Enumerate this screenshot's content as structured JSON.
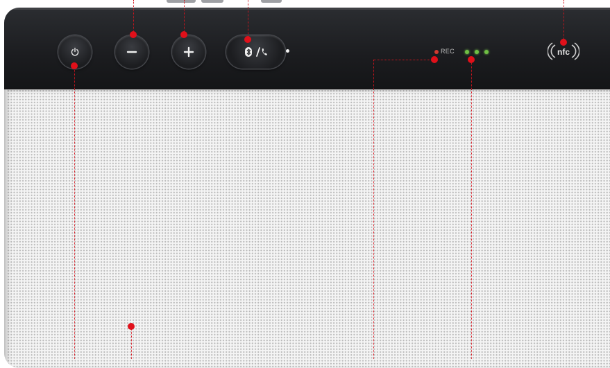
{
  "device": {
    "rec_label": "REC",
    "nfc_label": "nfc",
    "buttons": [
      {
        "name": "power",
        "icon": "power-icon"
      },
      {
        "name": "volume-down",
        "icon": "minus-icon"
      },
      {
        "name": "volume-up",
        "icon": "plus-icon"
      },
      {
        "name": "bluetooth-call",
        "icon": "bluetooth-phone-icon"
      }
    ],
    "battery_leds": 3,
    "colors": {
      "body": "#1b1c1f",
      "grille": "#f4f4f4",
      "callout": "#e0101a",
      "rec_led": "#d13a30",
      "battery_led": "#6fbf44"
    }
  }
}
